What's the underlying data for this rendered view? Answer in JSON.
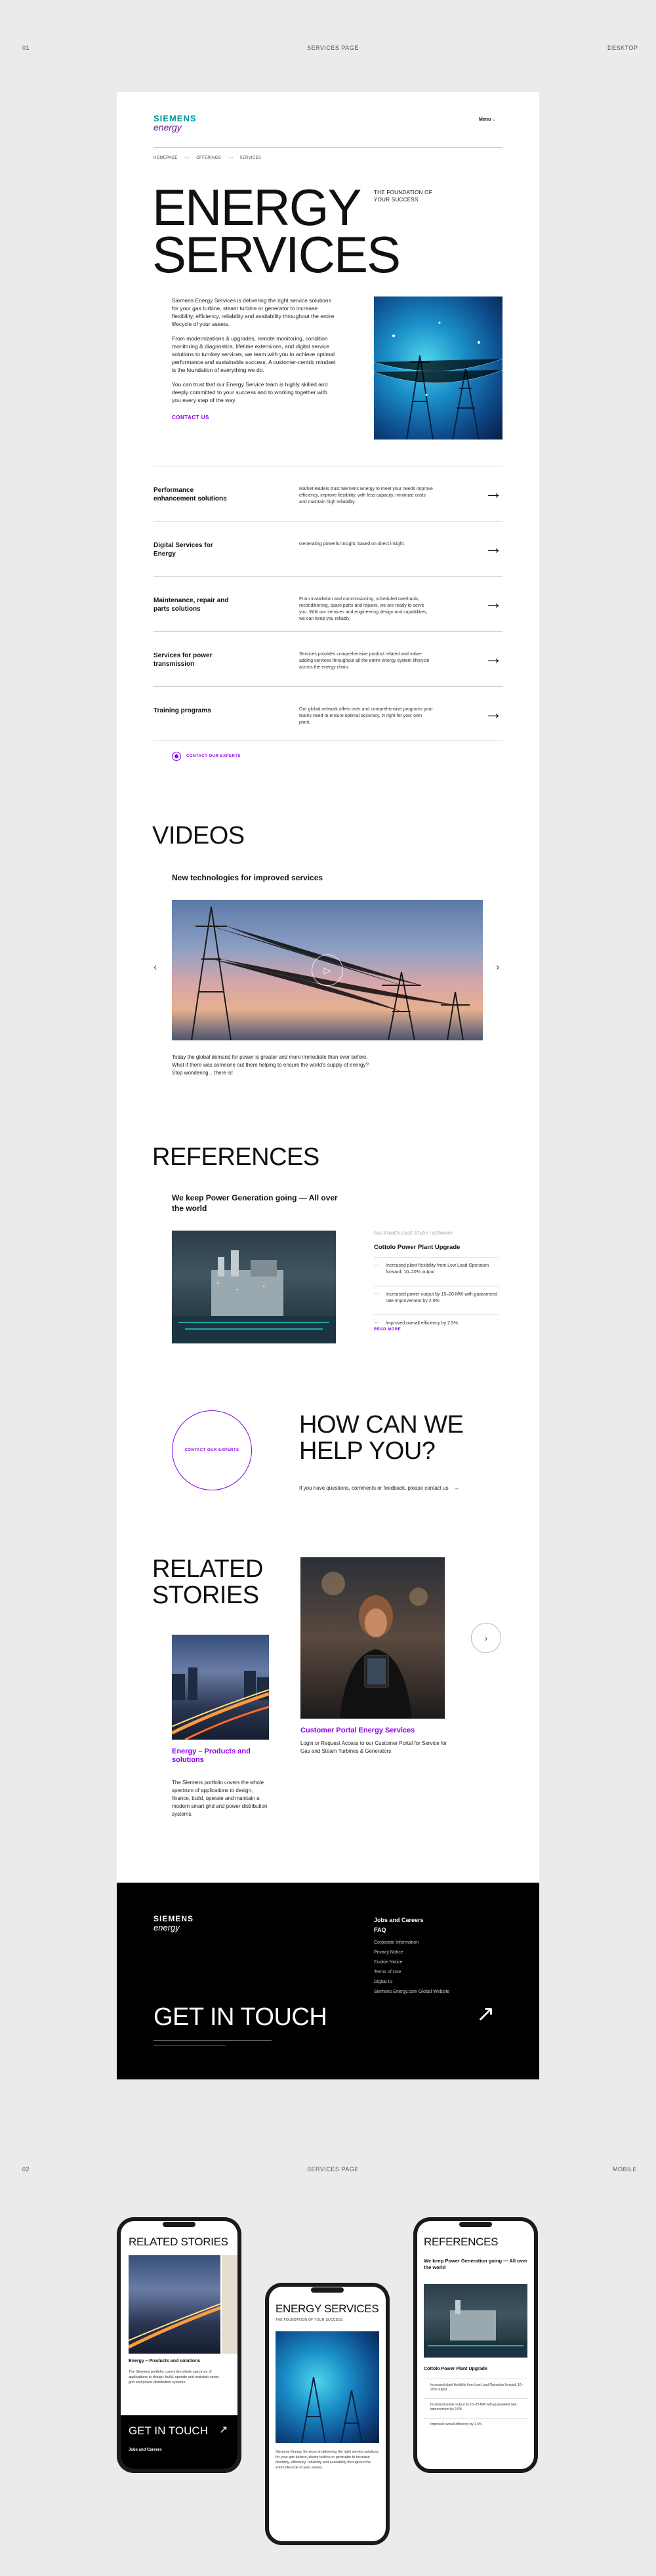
{
  "labels": {
    "top_left_num": "01",
    "top_center": "SERVICES PAGE",
    "top_right": "DESKTOP",
    "bottom_left_num": "02",
    "bottom_center": "SERVICES PAGE",
    "bottom_right": "MOBILE"
  },
  "brand": {
    "line1": "SIEMENS",
    "line2": "energy"
  },
  "nav": {
    "menu_label": "Menu",
    "menu_icon": "chevron-down-icon"
  },
  "breadcrumb": [
    "HOMEPAGE",
    "OFFERINGS",
    "SERVICES"
  ],
  "hero": {
    "title_line1": "ENERGY",
    "title_line2": "SERVICES",
    "foundation": "THE FOUNDATION OF YOUR SUCCESS",
    "intro_p1": "Siemens Energy Services is delivering the right service solutions for your gas turbine, steam turbine or generator to increase flexibility, efficiency, reliability and availability throughout the entire lifecycle of your assets.",
    "intro_p2": "From modernizations & upgrades, remote monitoring, condition monitoring & diagnostics, lifetime extensions, and digital service solutions to turnkey services, we team with you to achieve optimal performance and sustainable success. A customer-centric mindset is the foundation of everything we do.",
    "intro_p3": "You can trust that our Energy Service team is highly skilled and deeply committed to your success and to working together with you every step of the way.",
    "contact_link": "CONTACT US"
  },
  "services": [
    {
      "title": "Performance enhancement solutions",
      "desc": "Market leaders trust Siemens Energy to meet your needs improve efficiency, improve flexibility, with less capacity, minimize costs and maintain high reliability."
    },
    {
      "title": "Digital Services for Energy",
      "desc": "Generating powerful insight, based on direct insight."
    },
    {
      "title": "Maintenance, repair and parts solutions",
      "desc": "From installation and commissioning, scheduled overhauls, reconditioning, spare parts and repairs, we are ready to serve you. With our services and engineering design and capabilities, we can keep you reliably."
    },
    {
      "title": "Services for power transmission",
      "desc": "Services provides comprehensive product related and value-adding services throughout all the entire energy system lifecycle across the energy chain."
    },
    {
      "title": "Training programs",
      "desc": "Our global network offers over and comprehensive programs your teams need to ensure optimal accuracy, in right for your own plant."
    }
  ],
  "contact_experts": "CONTACT OUR EXPERTS",
  "videos": {
    "heading": "VIDEOS",
    "subheading": "New technologies for improved services",
    "caption": "Today the global demand for power is greater and more immediate than ever before. What if there was someone out there helping to ensure the world's supply of energy? Stop wondering... there is!"
  },
  "references": {
    "heading": "REFERENCES",
    "subheading": "We keep Power Generation going — All over the world",
    "case_label": "GAS POWER CASE STUDY / GERMANY",
    "case_title": "Cottolo Power Plant Upgrade",
    "items": [
      "Increased plant flexibility from Low Load Operation forward, 10–20% output",
      "Increased power output by 15–20 MW with guaranteed rate improvement by 2.0%",
      "Improved overall efficiency by 2.5%"
    ],
    "read_more": "READ MORE"
  },
  "help": {
    "circle_label": "CONTACT OUR EXPERTS",
    "heading_line1": "HOW CAN WE",
    "heading_line2": "HELP YOU?",
    "text": "If you have questions, comments or feedback, please contact us"
  },
  "related": {
    "heading_line1": "RELATED",
    "heading_line2": "STORIES",
    "story1_title": "Energy – Products and solutions",
    "story1_text": "The Siemens portfolio covers the whole spectrum of applications to design, finance, build, operate and maintain a modern smart grid and power distribution systems.",
    "story2_title": "Customer Portal Energy Services",
    "story2_text": "Login or Request Access to our Customer Portal for Service for Gas and Steam Turbines & Generators"
  },
  "footer": {
    "links_title1": "Jobs and Careers",
    "links_title2": "FAQ",
    "links": [
      "Corporate Information",
      "Privacy Notice",
      "Cookie Notice",
      "Terms of Use",
      "Digital ID",
      "Siemens Energy.com Global Website"
    ],
    "cta": "GET IN TOUCH",
    "cta_icon": "arrow-up-right-icon"
  },
  "mobile": {
    "phone1_heading": "RELATED STORIES",
    "phone1_story": "Energy – Products and solutions",
    "phone1_story_text": "The Siemens portfolio covers the whole spectrum of applications to design, build, operate and maintain smart grid and power distribution systems.",
    "phone1_cta": "GET IN TOUCH",
    "phone1_foot": "Jobs and Careers",
    "phone2_heading": "ENERGY SERVICES",
    "phone2_sub": "THE FOUNDATION OF YOUR SUCCESS",
    "phone2_text": "Siemens Energy Services is delivering the right service solutions for your gas turbine, steam turbine or generator to increase flexibility, efficiency, reliability and availability throughout the entire lifecycle of your assets.",
    "phone3_heading": "REFERENCES",
    "phone3_sub": "We keep Power Generation going — All over the world",
    "phone3_case": "Cottolo Power Plant Upgrade"
  },
  "colors": {
    "accent": "#8a00e5",
    "teal": "#009999",
    "brand_purple": "#641e8c"
  }
}
